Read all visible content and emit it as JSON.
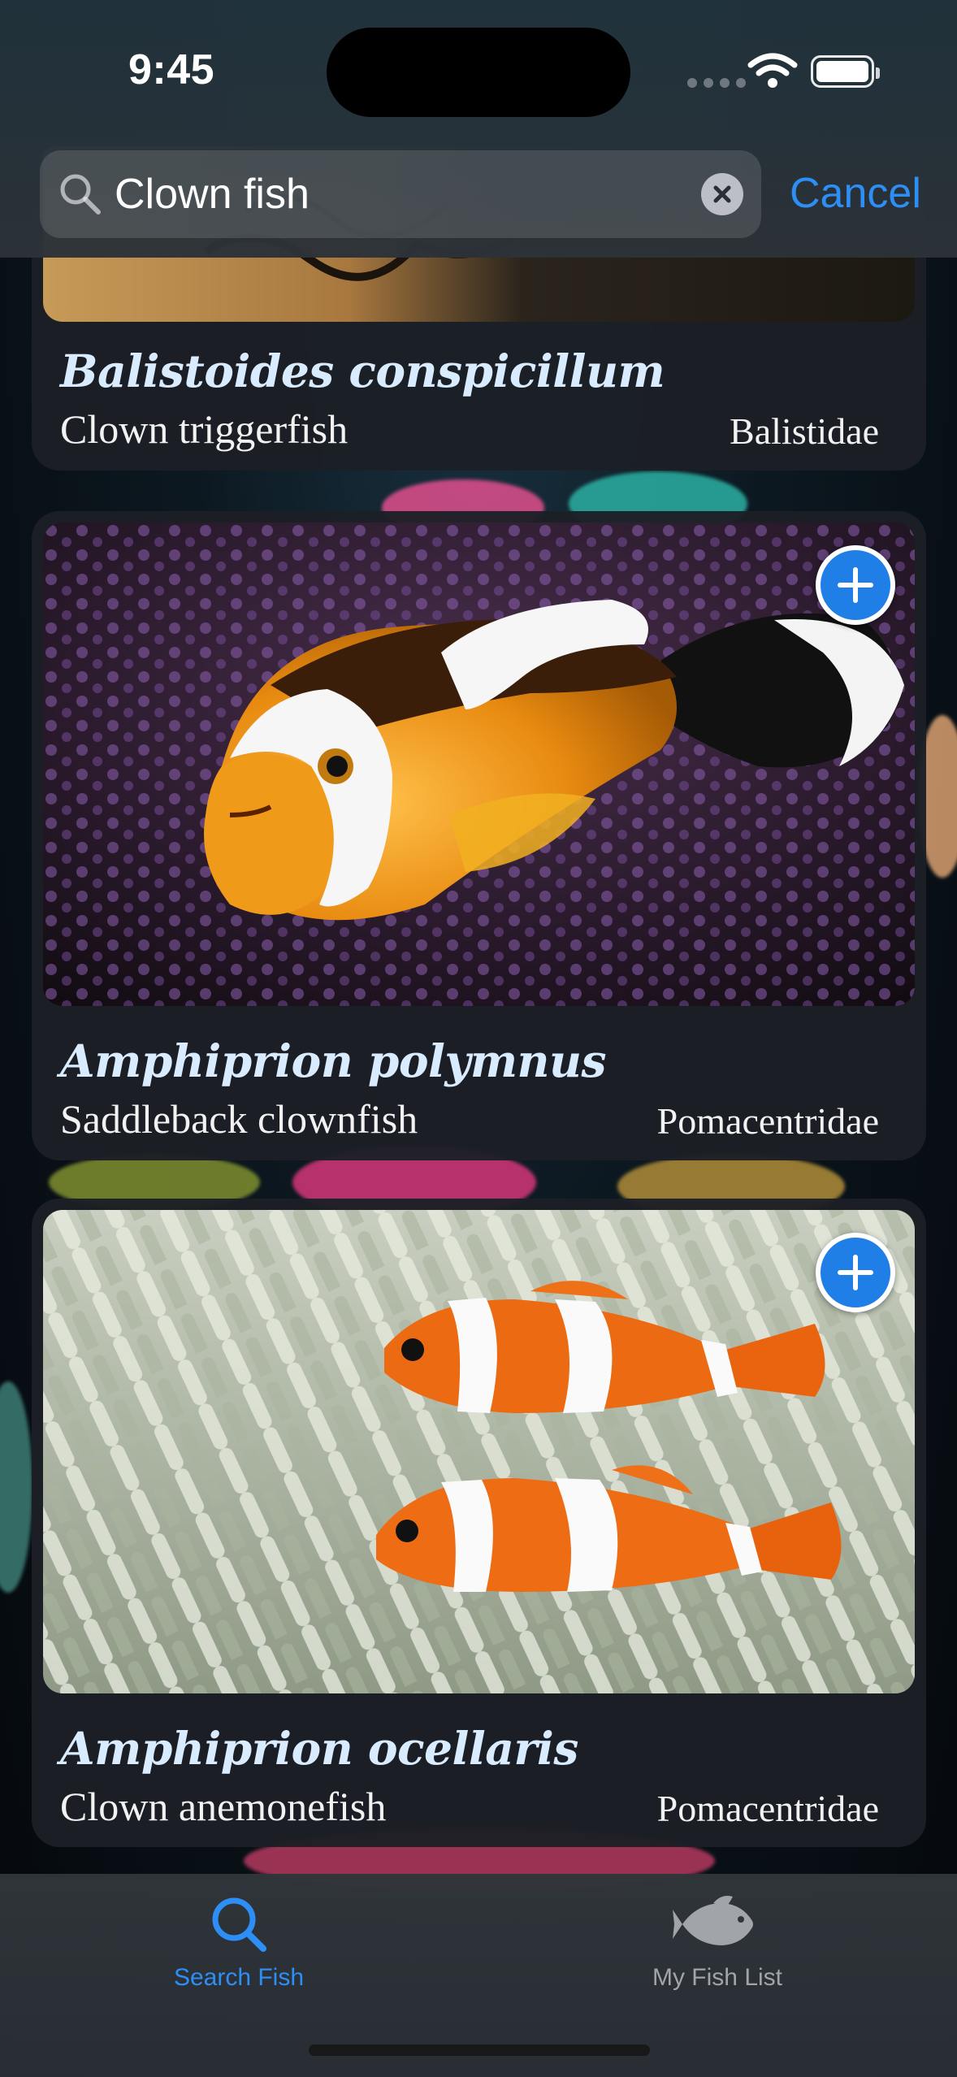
{
  "status_bar": {
    "time": "9:45"
  },
  "search": {
    "query": "Clown fish",
    "cancel_label": "Cancel"
  },
  "results": [
    {
      "scientific_name": "Balistoides conspicillum",
      "common_name": "Clown triggerfish",
      "family": "Balistidae"
    },
    {
      "scientific_name": "Amphiprion polymnus",
      "common_name": "Saddleback clownfish",
      "family": "Pomacentridae"
    },
    {
      "scientific_name": "Amphiprion ocellaris",
      "common_name": "Clown anemonefish",
      "family": "Pomacentridae"
    }
  ],
  "tabs": [
    {
      "label": "Search Fish",
      "icon": "search-icon",
      "selected": true
    },
    {
      "label": "My Fish List",
      "icon": "fish-icon",
      "selected": false
    }
  ],
  "colors": {
    "accent": "#2d8ff5",
    "add_button": "#1f7fe6",
    "scientific_name": "#d9ecff"
  }
}
